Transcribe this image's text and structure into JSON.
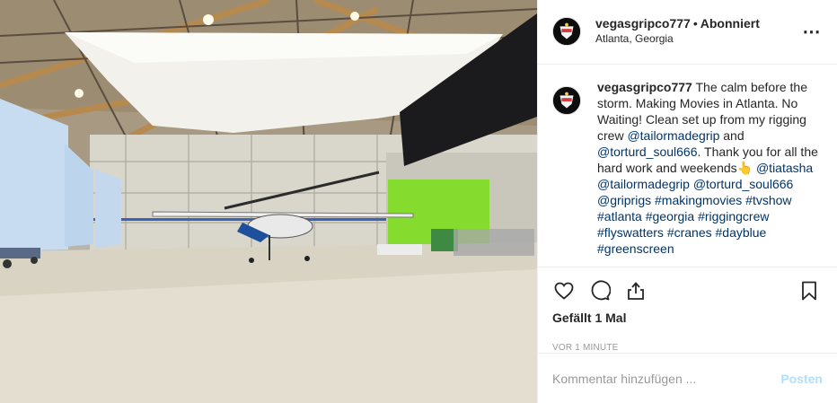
{
  "header": {
    "username": "vegasgripco777",
    "separator": "•",
    "follow_label": "Abonniert",
    "location": "Atlanta, Georgia",
    "more_icon": "more-horizontal-icon"
  },
  "caption": {
    "username": "vegasgripco777",
    "text_1": " The calm before the storm. Making Movies in Atlanta. No Waiting! Clean set up from my rigging crew ",
    "mention_1": "@tailormadegrip",
    "text_2": " and ",
    "mention_2": "@torturd_soul666",
    "text_3": ". Thank you for all the hard work and weekends👆 ",
    "mention_3": "@tiatasha",
    "mention_4": "@tailormadegrip",
    "mention_5": "@torturd_soul666",
    "mention_6": "@griprigs",
    "tag_1": "#makingmovies",
    "tag_2": "#tvshow",
    "tag_3": "#atlanta",
    "tag_4": "#georgia",
    "tag_5": "#riggingcrew",
    "tag_6": "#flyswatters",
    "tag_7": "#cranes",
    "tag_8": "#dayblue",
    "tag_9": "#greenscreen"
  },
  "actions": {
    "like_icon": "heart-icon",
    "comment_icon": "comment-icon",
    "share_icon": "share-icon",
    "save_icon": "bookmark-icon",
    "likes_text": "Gefällt 1 Mal",
    "timestamp": "VOR 1 MINUTE"
  },
  "add_comment": {
    "placeholder": "Kommentar hinzufügen ...",
    "post_label": "Posten"
  },
  "colors": {
    "link": "#003569",
    "post_disabled": "#b2dffc",
    "green_screen": "#86dc2e",
    "divider": "#efefef"
  }
}
